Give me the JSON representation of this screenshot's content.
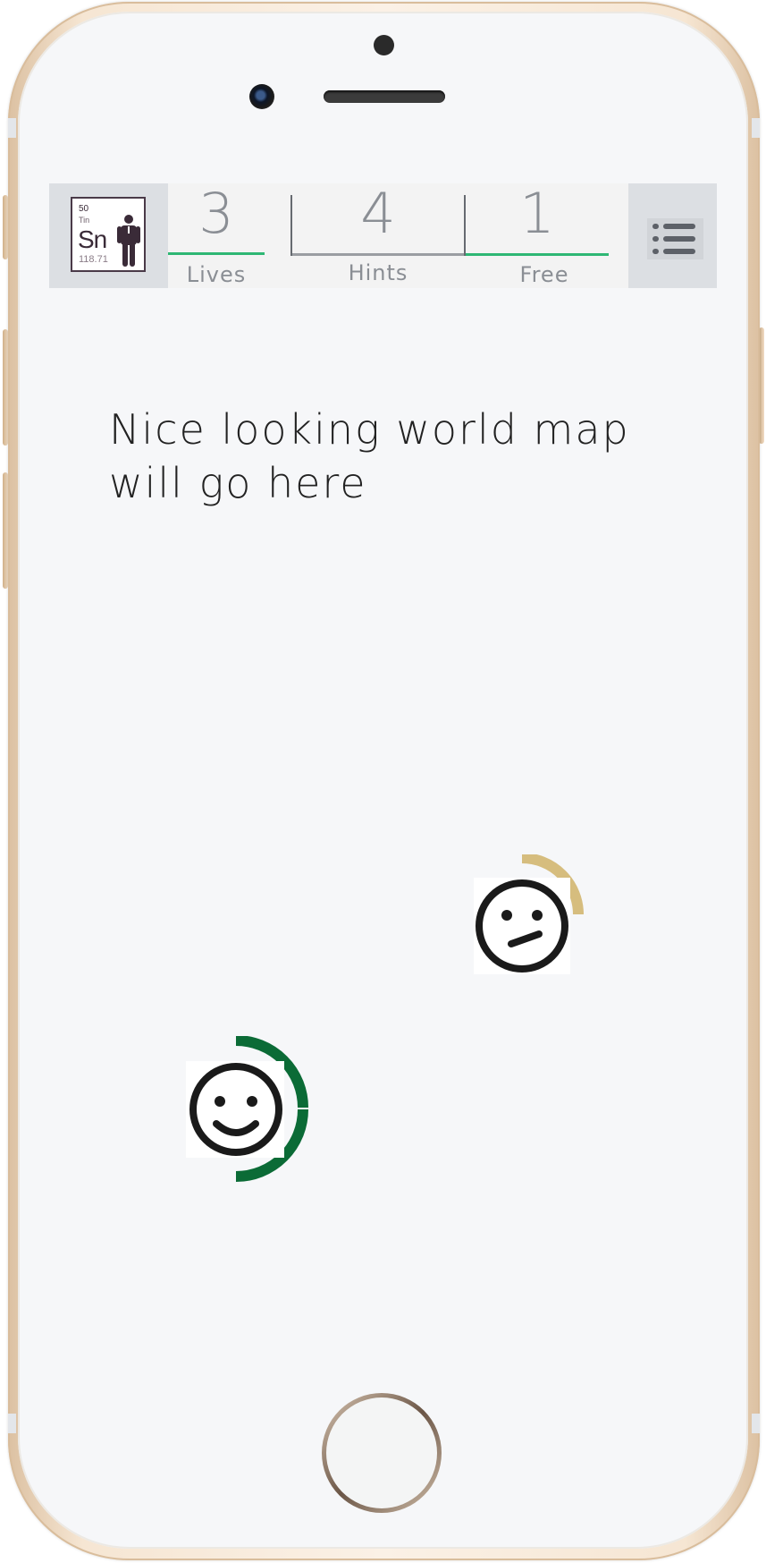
{
  "header": {
    "logo": {
      "atomic_number": "50",
      "element_name": "Tin",
      "symbol": "Sn",
      "atomic_mass": "118.71"
    },
    "stats": [
      {
        "value": "3",
        "label": "Lives",
        "bar_color": "#2eb774"
      },
      {
        "value": "4",
        "label": "Hints",
        "bar_color": "#9a9da2"
      },
      {
        "value": "1",
        "label": "Free",
        "bar_color": "#2eb774"
      }
    ],
    "menu_icon": "list-icon"
  },
  "map": {
    "placeholder_text_line1": "Nice looking world map",
    "placeholder_text_line2": "will go here"
  },
  "markers": [
    {
      "face": "neutral-face-icon",
      "ring_color": "#d6bd7e",
      "progress": 0.25
    },
    {
      "face": "smiley-face-icon",
      "ring_color": "#0b6b36",
      "progress": 0.5
    }
  ],
  "colors": {
    "accent_green": "#2eb774",
    "dark_green": "#0b6b36",
    "gold": "#d6bd7e",
    "header_bg": "#dcdfe3"
  }
}
